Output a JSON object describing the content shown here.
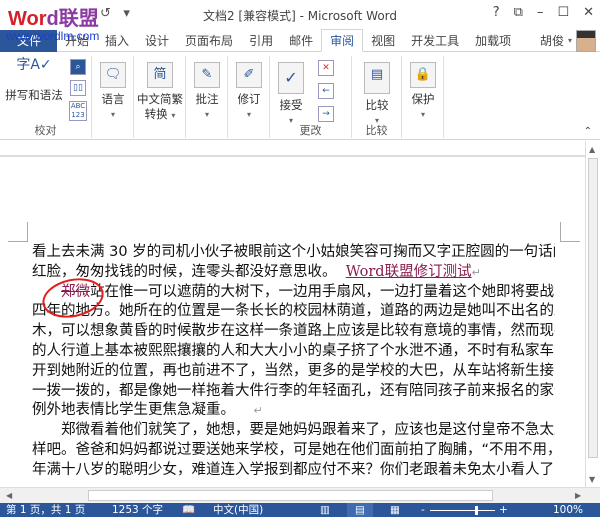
{
  "watermark": {
    "logo_text": "Word联盟",
    "url": "www.wordlm.com"
  },
  "titlebar": {
    "title": "文档2 [兼容模式] - Microsoft Word",
    "help": "?",
    "restore": "⧉",
    "minimize": "–",
    "maximize": "☐",
    "close": "✕",
    "undo": "↺",
    "customize": "▾"
  },
  "tabs": [
    {
      "label": "文件"
    },
    {
      "label": "开始"
    },
    {
      "label": "插入"
    },
    {
      "label": "设计"
    },
    {
      "label": "页面布局"
    },
    {
      "label": "引用"
    },
    {
      "label": "邮件"
    },
    {
      "label": "审阅",
      "active": true
    },
    {
      "label": "视图"
    },
    {
      "label": "开发工具"
    },
    {
      "label": "加载项"
    }
  ],
  "user": {
    "name": "胡俊",
    "caret": "▾"
  },
  "ribbon": {
    "groups": [
      {
        "label": "校对"
      },
      {
        "label": ""
      },
      {
        "label": ""
      },
      {
        "label": ""
      },
      {
        "label": ""
      },
      {
        "label": "更改"
      },
      {
        "label": "比较"
      },
      {
        "label": ""
      }
    ],
    "spelling": "拼写和语法",
    "spelling_icon": "字A✓",
    "abc": "ABC 123",
    "language": "语言",
    "chinese_conv_1": "中文简繁",
    "chinese_conv_2": "转换",
    "conv_icon": "简",
    "comment": "批注",
    "track": "修订",
    "accept": "接受",
    "compare": "比较",
    "protect": "保护",
    "caret": "▾",
    "collapse": "⌃"
  },
  "document": {
    "lines": [
      "看上去未满 30 岁的司机小伙子被眼前这个小姑娘笑容可掬而又字正腔圆的一句话闹了个大",
      "红脸，匆匆找钱的时候，连零头都没好意思收。",
      "站在惟一可以遮荫的大树下，一边用手扇风，一边打量着这个她即将要战斗和生活",
      "四年的地方。她所在的位置是一条长长的校园林荫道，道路的两边是她叫不出名的亚热带树",
      "木，可以想象黄昏的时候散步在这样一条道路上应该是比较有意境的事情，然而现在整条路",
      "的人行道上基本被熙熙攘攘的人和大大小小的桌子挤了个水泄不通，不时有私家车、出租车",
      "开到她附近的位置，再也前进不了，当然，更多的是学校的大巴，从车站将新生接了过来，",
      "一拨一拨的，都是像她一样拖着大件行李的年轻面孔，还有陪同孩子前来报名的家长，无一",
      "例外地表情比学生更焦急凝重。",
      "郑微看着他们就笑了，她想，要是她妈妈跟着来了，应该也是这付皇帝不急太监急的模",
      "样吧。爸爸和妈妈都说过要送她来学校，可是她在他们面前拍了胸脯，“不用不用，我一个",
      "年满十八岁的聪明少女，难道连入学报到都应付不来？你们老跟着未免太小看人了，别忘了"
    ],
    "inserted_revision": "Word联盟修订测试",
    "deleted_revision": "郑微",
    "paragraph_mark": "↵"
  },
  "statusbar": {
    "page": "第 1 页，共 1 页",
    "words": "1253 个字",
    "language": "中文(中国)",
    "zoom_minus": "-",
    "zoom_plus": "+",
    "zoom": "100%",
    "zoom_percent": 100
  },
  "colors": {
    "accent": "#2b579a",
    "revision": "#8b1c4f",
    "annotation_circle": "#e02020"
  }
}
